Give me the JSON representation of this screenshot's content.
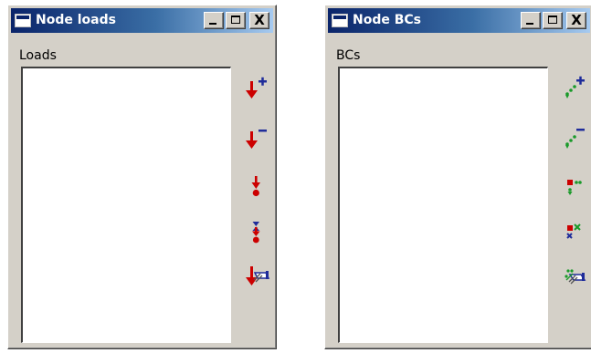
{
  "left_window": {
    "title": "Node loads",
    "label": "Loads",
    "tools": [
      {
        "name": "add-load-button",
        "icon": "add-load-icon"
      },
      {
        "name": "remove-load-button",
        "icon": "remove-load-icon"
      },
      {
        "name": "select-load-button",
        "icon": "point-load-icon"
      },
      {
        "name": "move-load-button",
        "icon": "move-load-icon"
      },
      {
        "name": "erase-load-button",
        "icon": "erase-load-icon"
      }
    ]
  },
  "right_window": {
    "title": "Node BCs",
    "label": "BCs",
    "tools": [
      {
        "name": "add-bc-button",
        "icon": "add-bc-icon"
      },
      {
        "name": "remove-bc-button",
        "icon": "remove-bc-icon"
      },
      {
        "name": "select-bc-button",
        "icon": "point-bc-icon"
      },
      {
        "name": "delete-bc-button",
        "icon": "delete-bc-icon"
      },
      {
        "name": "erase-bc-button",
        "icon": "erase-bc-icon"
      }
    ]
  },
  "window_controls": {
    "close_symbol": "X"
  },
  "colors": {
    "load_red": "#cc0000",
    "bc_green": "#1a9a2a",
    "bc_blue": "#1f2c9a",
    "titlebar_start": "#0a246a"
  }
}
